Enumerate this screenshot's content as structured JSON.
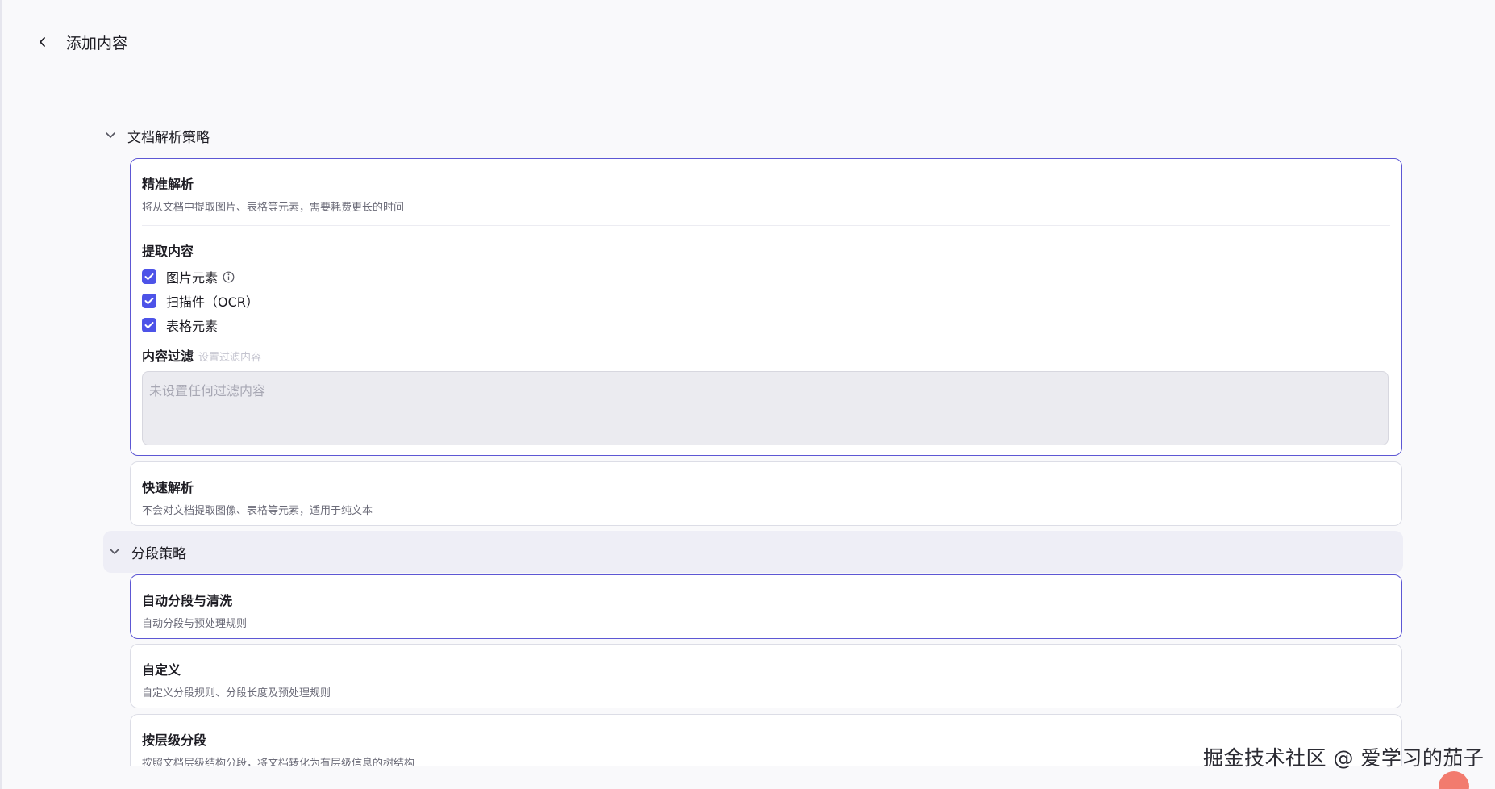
{
  "header": {
    "title": "添加内容"
  },
  "parse_section": {
    "label": "文档解析策略",
    "precise": {
      "title": "精准解析",
      "desc": "将从文档中提取图片、表格等元素，需要耗费更长的时间",
      "extract_title": "提取内容",
      "options": [
        {
          "label": "图片元素",
          "checked": true
        },
        {
          "label": "扫描件（OCR）",
          "checked": true
        },
        {
          "label": "表格元素",
          "checked": true
        }
      ],
      "filter_title": "内容过滤",
      "filter_hint": "设置过滤内容",
      "filter_placeholder": "未设置任何过滤内容"
    },
    "fast": {
      "title": "快速解析",
      "desc": "不会对文档提取图像、表格等元素，适用于纯文本"
    }
  },
  "segment_section": {
    "label": "分段策略",
    "items": [
      {
        "title": "自动分段与清洗",
        "desc": "自动分段与预处理规则"
      },
      {
        "title": "自定义",
        "desc": "自定义分段规则、分段长度及预处理规则"
      },
      {
        "title": "按层级分段",
        "desc": "按照文档层级结构分段，将文档转化为有层级信息的树结构"
      }
    ]
  },
  "watermark": "掘金技术社区 @ 爱学习的茄子",
  "colors": {
    "accent": "#4d53e8",
    "selected_border": "#5d57d4",
    "section_highlight": "#eeeef6"
  }
}
